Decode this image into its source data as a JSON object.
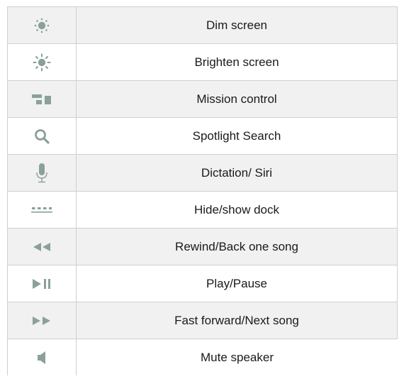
{
  "icon_color": "#8aa198",
  "rows": [
    {
      "icon": "dim-brightness-icon",
      "label": "Dim screen"
    },
    {
      "icon": "brighten-icon",
      "label": "Brighten screen"
    },
    {
      "icon": "mission-control-icon",
      "label": "Mission control"
    },
    {
      "icon": "search-icon",
      "label": "Spotlight Search"
    },
    {
      "icon": "microphone-icon",
      "label": "Dictation/ Siri"
    },
    {
      "icon": "dock-icon",
      "label": "Hide/show dock"
    },
    {
      "icon": "rewind-icon",
      "label": "Rewind/Back one song"
    },
    {
      "icon": "play-pause-icon",
      "label": "Play/Pause"
    },
    {
      "icon": "fast-forward-icon",
      "label": "Fast forward/Next song"
    },
    {
      "icon": "mute-speaker-icon",
      "label": "Mute speaker"
    }
  ]
}
